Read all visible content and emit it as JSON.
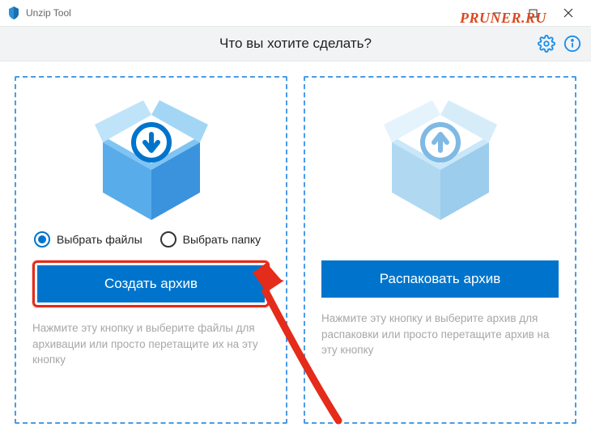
{
  "window": {
    "title": "Unzip Tool"
  },
  "watermark": "PRUNER.RU",
  "header": {
    "title": "Что вы хотите сделать?"
  },
  "panels": {
    "left": {
      "radio1": "Выбрать файлы",
      "radio2": "Выбрать папку",
      "button": "Создать архив",
      "hint": "Нажмите эту кнопку и выберите файлы для архивации или просто перетащите их на эту кнопку"
    },
    "right": {
      "button": "Распаковать архив",
      "hint": "Нажмите эту кнопку и выберите архив для распаковки или просто перетащите архив на эту кнопку"
    }
  },
  "colors": {
    "accent": "#0074cc",
    "highlight": "#e52b1a",
    "panel_border": "#4a9be8"
  }
}
